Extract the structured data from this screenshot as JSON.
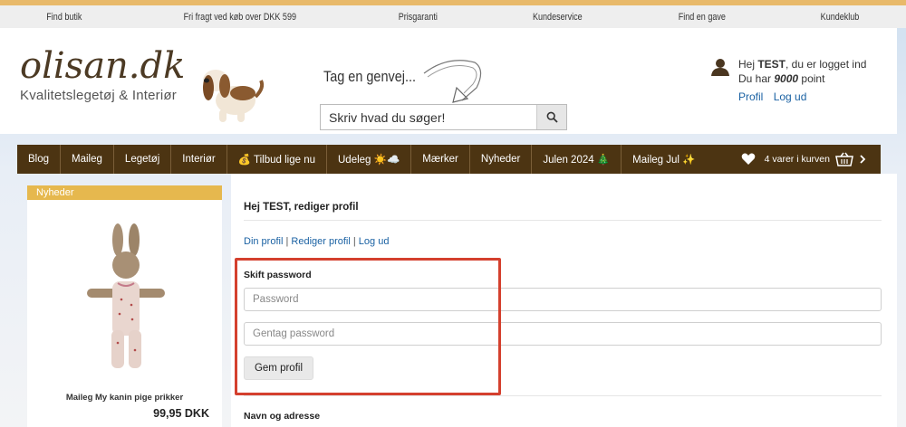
{
  "top_bar": {
    "items": [
      "Find butik",
      "Fri fragt ved køb over DKK 599",
      "Prisgaranti",
      "Kundeservice",
      "Find en gave",
      "Kundeklub"
    ]
  },
  "logo": {
    "main": "olisan.dk",
    "sub": "Kvalitetslegetøj & Interiør"
  },
  "shortcut_text": "Tag en genvej...",
  "search": {
    "placeholder": "Skriv hvad du søger!"
  },
  "user": {
    "greeting_prefix": "Hej ",
    "name": "TEST",
    "greeting_suffix": ", du er logget ind",
    "points_prefix": "Du har ",
    "points": "9000",
    "points_suffix": " point",
    "profile_link": "Profil",
    "logout_link": "Log ud"
  },
  "nav": {
    "items": [
      "Blog",
      "Maileg",
      "Legetøj",
      "Interiør",
      "💰 Tilbud lige nu",
      "Udeleg ☀️☁️",
      "Mærker",
      "Nyheder",
      "Julen 2024 🎄",
      "Maileg Jul ✨"
    ],
    "cart_text": "4 varer i kurven"
  },
  "sidebar": {
    "tab_label": "Nyheder",
    "product_name": "Maileg My kanin pige prikker",
    "product_price": "99,95 DKK"
  },
  "main": {
    "title": "Hej TEST, rediger profil",
    "links": [
      "Din profil",
      "Rediger profil",
      "Log ud"
    ],
    "link_separator": " | ",
    "password_section": "Skift password",
    "password_placeholder": "Password",
    "repeat_placeholder": "Gentag password",
    "save_label": "Gem profil",
    "address_section": "Navn og adresse"
  },
  "colors": {
    "nav_bg": "#4c3412",
    "accent_yellow": "#e6b84e",
    "link_blue": "#1b62a3",
    "highlight_red": "#d4402e"
  }
}
